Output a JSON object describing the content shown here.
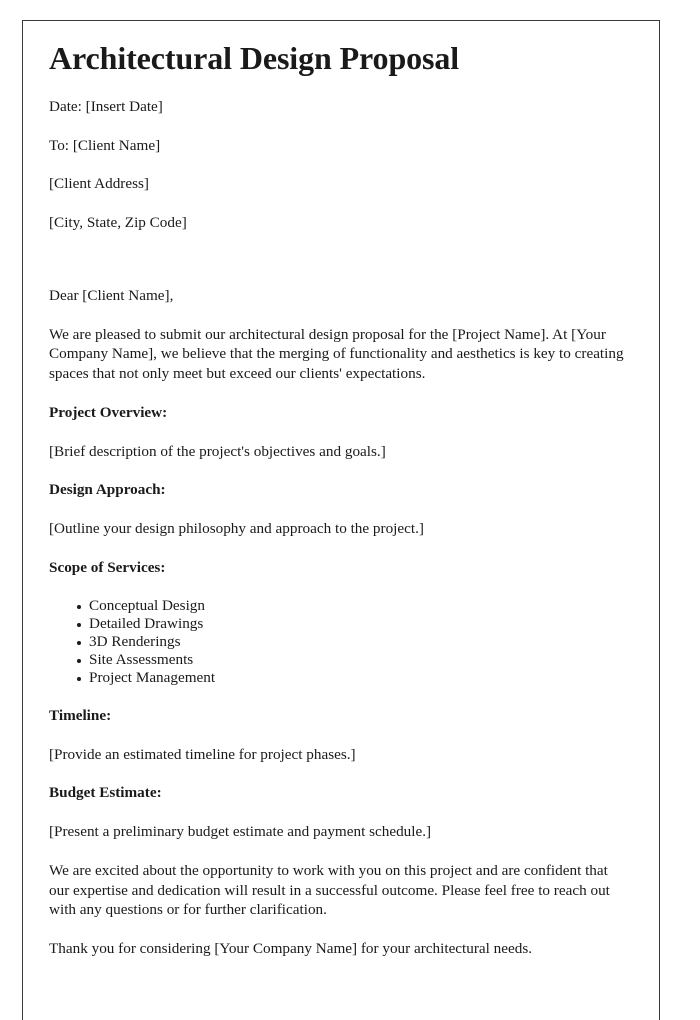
{
  "document": {
    "title": "Architectural Design Proposal",
    "header": {
      "date_line": "Date: [Insert Date]",
      "to_line": "To: [Client Name]",
      "address_line": "[Client Address]",
      "city_state_zip_line": "[City, State, Zip Code]"
    },
    "salutation": "Dear [Client Name],",
    "intro_paragraph": "We are pleased to submit our architectural design proposal for the [Project Name]. At [Your Company Name], we believe that the merging of functionality and aesthetics is key to creating spaces that not only meet but exceed our clients' expectations.",
    "sections": [
      {
        "heading": "Project Overview:",
        "body": "[Brief description of the project's objectives and goals.]"
      },
      {
        "heading": "Design Approach:",
        "body": "[Outline your design philosophy and approach to the project.]"
      },
      {
        "heading": "Scope of Services:",
        "items": [
          "Conceptual Design",
          "Detailed Drawings",
          "3D Renderings",
          "Site Assessments",
          "Project Management"
        ]
      },
      {
        "heading": "Timeline:",
        "body": "[Provide an estimated timeline for project phases.]"
      },
      {
        "heading": "Budget Estimate:",
        "body": "[Present a preliminary budget estimate and payment schedule.]"
      }
    ],
    "closing_paragraph": "We are excited about the opportunity to work with you on this project and are confident that our expertise and dedication will result in a successful outcome. Please feel free to reach out with any questions or for further clarification.",
    "thank_you_paragraph": "Thank you for considering [Your Company Name] for your architectural needs.",
    "colors": {
      "page_background": "#ffffff",
      "page_border": "#3a3a3a",
      "text": "#1a1a1a"
    }
  }
}
